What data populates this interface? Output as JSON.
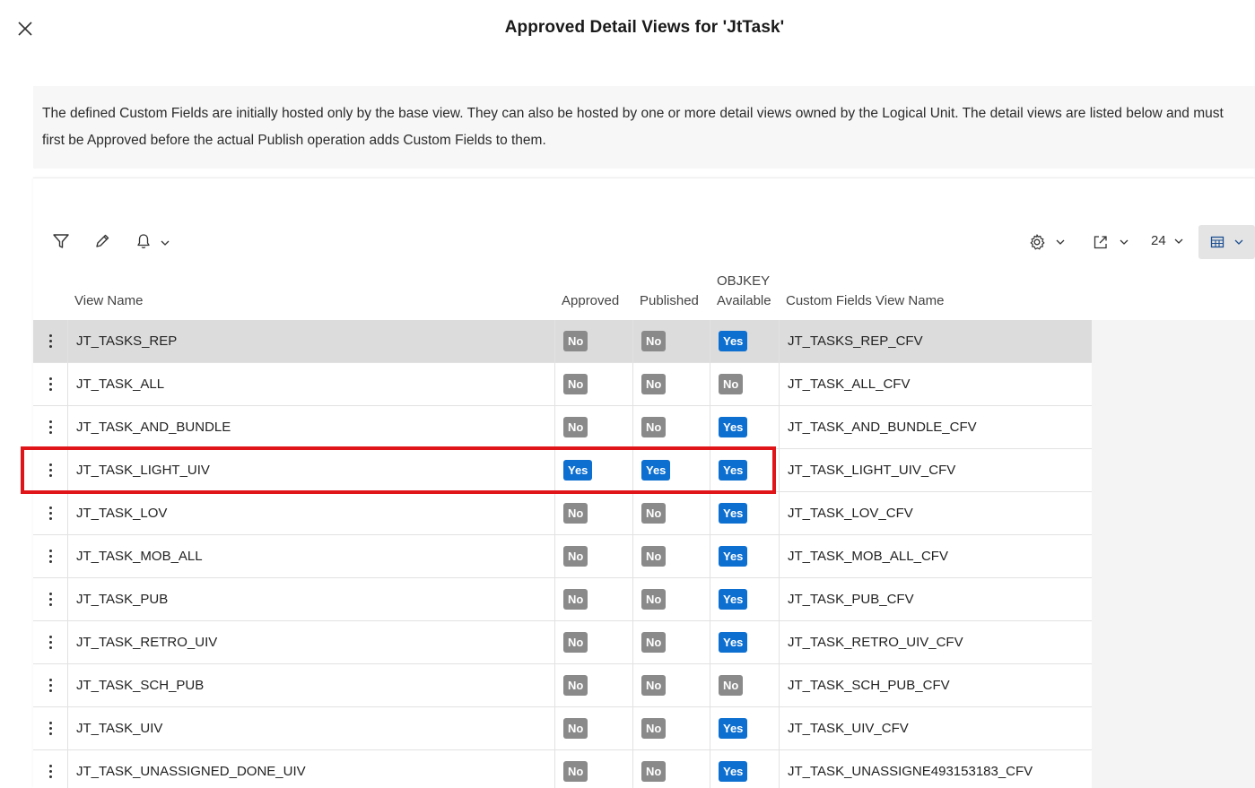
{
  "dialog": {
    "title": "Approved Detail Views for 'JtTask'",
    "close_icon": "close-icon"
  },
  "info": {
    "text": "The defined Custom Fields are initially hosted only by the base view. They can also be hosted by one or more detail views owned by the Logical Unit. The detail views are listed below and must first be Approved before the actual Publish operation adds Custom Fields to them."
  },
  "toolbar": {
    "icons": [
      "filter-icon",
      "edit-icon",
      "bell-icon",
      "settings-icon",
      "export-icon",
      "table-view-icon"
    ],
    "page_size": "24"
  },
  "columns": {
    "view_name": "View Name",
    "approved": "Approved",
    "published": "Published",
    "objkey_line1": "OBJKEY",
    "objkey_line2": "Available",
    "cf_view_name": "Custom Fields View Name"
  },
  "colors": {
    "yes_badge": "#0d6fd0",
    "no_badge": "#8a8a8a",
    "highlight": "#e0151a"
  },
  "rows": [
    {
      "view": "JT_TASKS_REP",
      "approved": "No",
      "published": "No",
      "objkey": "Yes",
      "cfv": "JT_TASKS_REP_CFV",
      "selected": true
    },
    {
      "view": "JT_TASK_ALL",
      "approved": "No",
      "published": "No",
      "objkey": "No",
      "cfv": "JT_TASK_ALL_CFV"
    },
    {
      "view": "JT_TASK_AND_BUNDLE",
      "approved": "No",
      "published": "No",
      "objkey": "Yes",
      "cfv": "JT_TASK_AND_BUNDLE_CFV"
    },
    {
      "view": "JT_TASK_LIGHT_UIV",
      "approved": "Yes",
      "published": "Yes",
      "objkey": "Yes",
      "cfv": "JT_TASK_LIGHT_UIV_CFV",
      "highlighted": true
    },
    {
      "view": "JT_TASK_LOV",
      "approved": "No",
      "published": "No",
      "objkey": "Yes",
      "cfv": "JT_TASK_LOV_CFV"
    },
    {
      "view": "JT_TASK_MOB_ALL",
      "approved": "No",
      "published": "No",
      "objkey": "Yes",
      "cfv": "JT_TASK_MOB_ALL_CFV"
    },
    {
      "view": "JT_TASK_PUB",
      "approved": "No",
      "published": "No",
      "objkey": "Yes",
      "cfv": "JT_TASK_PUB_CFV"
    },
    {
      "view": "JT_TASK_RETRO_UIV",
      "approved": "No",
      "published": "No",
      "objkey": "Yes",
      "cfv": "JT_TASK_RETRO_UIV_CFV"
    },
    {
      "view": "JT_TASK_SCH_PUB",
      "approved": "No",
      "published": "No",
      "objkey": "No",
      "cfv": "JT_TASK_SCH_PUB_CFV"
    },
    {
      "view": "JT_TASK_UIV",
      "approved": "No",
      "published": "No",
      "objkey": "Yes",
      "cfv": "JT_TASK_UIV_CFV"
    },
    {
      "view": "JT_TASK_UNASSIGNED_DONE_UIV",
      "approved": "No",
      "published": "No",
      "objkey": "Yes",
      "cfv": "JT_TASK_UNASSIGNE493153183_CFV"
    }
  ]
}
